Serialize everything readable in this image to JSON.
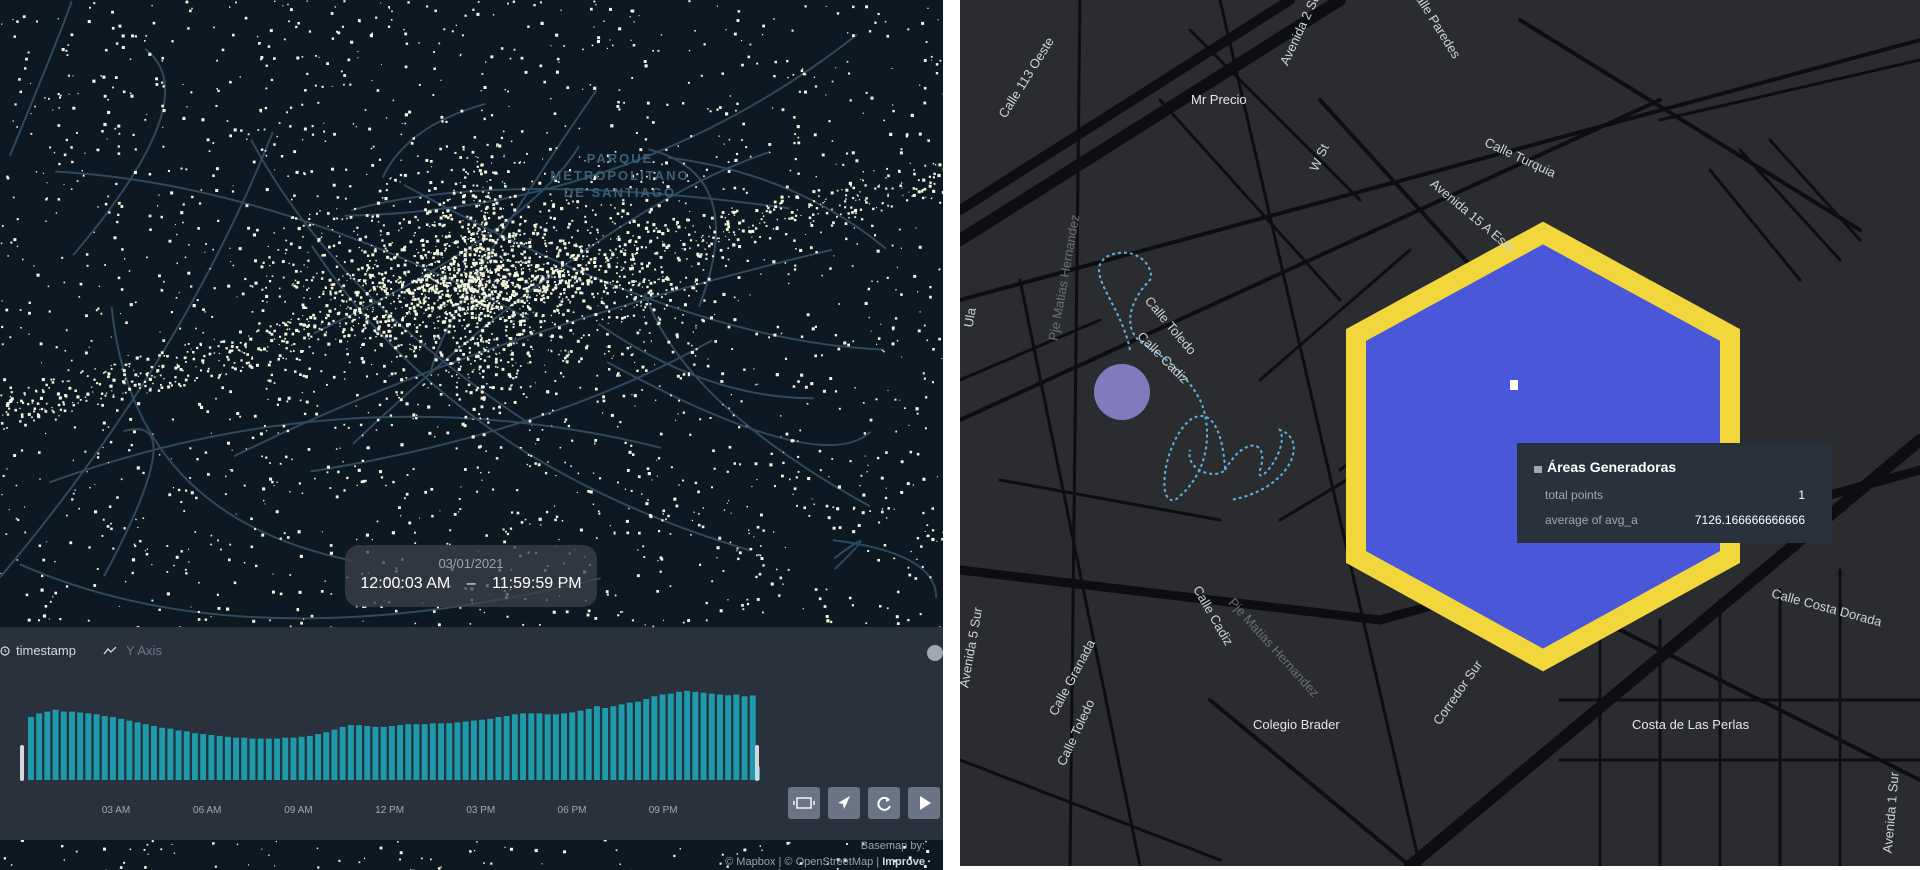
{
  "left_map": {
    "park_label_lines": [
      "PARQUE",
      "METROPOLITANO",
      "DE SANTIAGO"
    ],
    "colors": {
      "background": "#0c1822",
      "points": "#f5f3dc",
      "roads": "#2f4a5c"
    }
  },
  "time_display": {
    "date": "03/01/2021",
    "start_time": "12:00:03 AM",
    "separator": "–",
    "end_time": "11:59:59 PM"
  },
  "timeline": {
    "field_label": "timestamp",
    "y_axis_label": "Y Axis",
    "icons": [
      "clock-icon",
      "line-chart-icon"
    ],
    "controls": [
      {
        "name": "window-button",
        "icon": "window-icon"
      },
      {
        "name": "speed-button",
        "icon": "rocket-icon"
      },
      {
        "name": "reset-button",
        "icon": "reset-icon"
      },
      {
        "name": "play-button",
        "icon": "play-icon"
      }
    ],
    "colors": {
      "bars": "#1e9aad",
      "panel": "#29323c"
    }
  },
  "chart_data": {
    "type": "bar",
    "xlabel": "",
    "ylabel": "",
    "tick_labels": [
      "03 AM",
      "06 AM",
      "09 AM",
      "12 PM",
      "03 PM",
      "06 PM",
      "09 PM"
    ],
    "values": [
      70,
      74,
      76,
      78,
      76,
      76,
      75,
      74,
      73,
      71,
      70,
      68,
      66,
      64,
      62,
      60,
      58,
      57,
      55,
      54,
      52,
      51,
      50,
      49,
      48,
      47,
      47,
      46,
      46,
      46,
      46,
      47,
      47,
      48,
      49,
      51,
      53,
      56,
      59,
      61,
      61,
      60,
      59,
      59,
      60,
      61,
      62,
      62,
      62,
      63,
      63,
      63,
      64,
      65,
      66,
      67,
      68,
      70,
      71,
      73,
      74,
      74,
      74,
      73,
      73,
      74,
      75,
      77,
      79,
      82,
      80,
      82,
      84,
      86,
      87,
      90,
      93,
      95,
      96,
      98,
      99,
      98,
      97,
      96,
      95,
      94,
      95,
      93,
      94
    ],
    "last_bar_value": 15,
    "ylim": [
      0,
      100
    ]
  },
  "basemap_credit": {
    "line1": "Basemap by:",
    "line2_prefix": "© Mapbox | © OpenStreetMap |",
    "improve": "Improve"
  },
  "right_map": {
    "street_labels": [
      "Calle 113 Oeste",
      "Avenida 2 Sur",
      "Calle Paredes",
      "W St",
      "Calle Turquia",
      "Avenida 15 A Este",
      "Pje Matias Hernandez",
      "Calle Toledo",
      "Calle Cadiz",
      "Calle Cadiz",
      "Pje Matias Hernandez",
      "Calle Granada",
      "Calle Toledo",
      "Corredor Sur",
      "Calle Costa Dorada",
      "Avenida 5 Sur",
      "Avenida 1 Sur",
      "Ula"
    ],
    "place_labels": [
      "Mr Precio",
      "Colegio Brader",
      "Costa de Las Perlas"
    ],
    "colors": {
      "background": "#2a2c30",
      "hexagon_fill": "#4a57d8",
      "hexagon_stroke": "#f2d73c",
      "path": "#5ab4e0"
    }
  },
  "tooltip": {
    "title": "Áreas Generadoras",
    "icon": "layer-icon",
    "rows": [
      {
        "label": "total points",
        "value": "1"
      },
      {
        "label": "average of avg_a",
        "value": "7126.166666666666"
      }
    ]
  }
}
